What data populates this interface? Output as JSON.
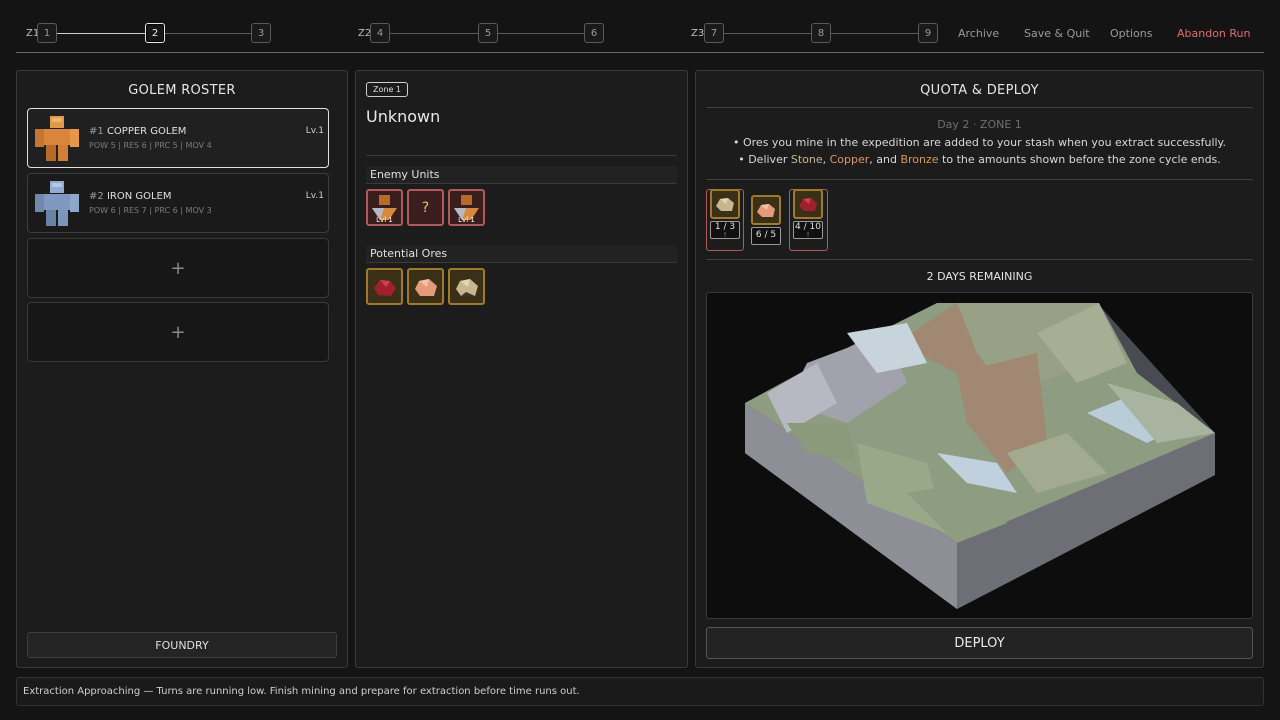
{
  "progress": {
    "zones": [
      {
        "label": "Z1",
        "nodes": [
          "1",
          "2",
          "3"
        ]
      },
      {
        "label": "Z2",
        "nodes": [
          "4",
          "5",
          "6"
        ]
      },
      {
        "label": "Z3",
        "nodes": [
          "7",
          "8",
          "9"
        ]
      }
    ],
    "current_node": "2"
  },
  "topnav": {
    "archive": "Archive",
    "save_quit": "Save & Quit",
    "options": "Options",
    "abandon": "Abandon Run"
  },
  "roster": {
    "title": "GOLEM ROSTER",
    "golems": [
      {
        "num": "#1",
        "name": "COPPER GOLEM",
        "level": "Lv.1",
        "stats": "POW 5 | RES 6 | PRC 5 | MOV 4",
        "color": "#d9853b",
        "selected": true
      },
      {
        "num": "#2",
        "name": "IRON GOLEM",
        "level": "Lv.1",
        "stats": "POW 6 | RES 7 | PRC 6 | MOV 3",
        "color": "#7e98bf",
        "selected": false
      }
    ],
    "empty_slot_symbol": "+",
    "foundry_label": "FOUNDRY"
  },
  "zone": {
    "tag": "Zone 1",
    "name": "Unknown",
    "enemy_heading": "Enemy Units",
    "enemies": [
      {
        "icon": "golem-enemy-icon",
        "label": "Lvl 1"
      },
      {
        "icon": "unknown-enemy-icon",
        "label": "?"
      },
      {
        "icon": "golem-enemy-icon",
        "label": "Lvl 1"
      }
    ],
    "ores_heading": "Potential Ores",
    "ores": [
      "ruby-ore-icon",
      "copper-ore-icon",
      "stone-ore-icon"
    ]
  },
  "quota": {
    "title": "QUOTA & DEPLOY",
    "day_line": "Day 2 · ZONE 1",
    "info1": "• Ores you mine in the expedition are added to your stash when you extract successfully.",
    "info2_pre": "• Deliver ",
    "stone": "Stone",
    "sep1": ", ",
    "copper": "Copper",
    "sep2": ", and ",
    "bronze": "Bronze",
    "info2_post": " to the amounts shown before the zone cycle ends.",
    "items": [
      {
        "icon": "stone-ore-icon",
        "count": "1 / 3",
        "short": true
      },
      {
        "icon": "copper-ore-icon",
        "count": "6 / 5",
        "short": false
      },
      {
        "icon": "bronze-ore-icon",
        "count": "4 / 10",
        "short": true
      }
    ],
    "short_marker": "!",
    "remaining": "2 DAYS REMAINING",
    "deploy_label": "DEPLOY"
  },
  "status": "Extraction Approaching — Turns are running low. Finish mining and prepare for extraction before time runs out."
}
